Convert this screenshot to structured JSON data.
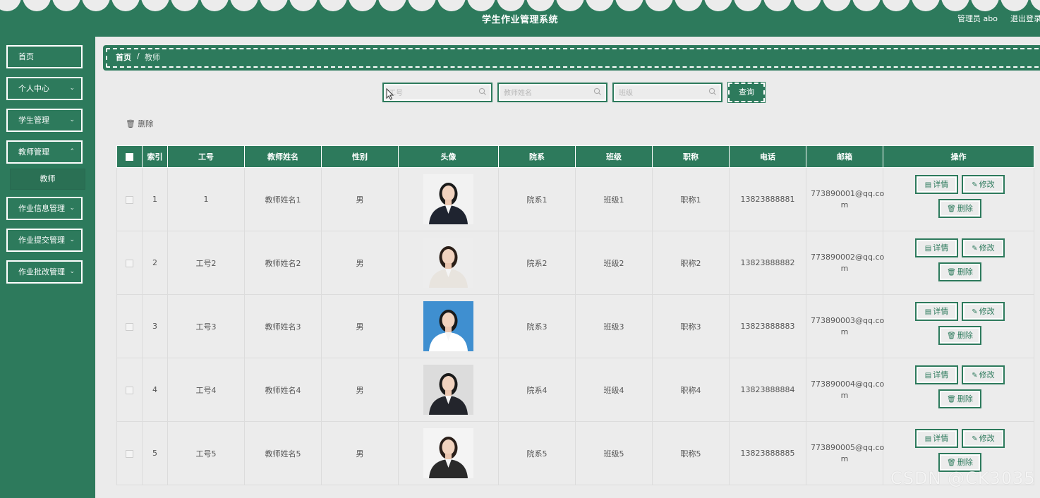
{
  "header": {
    "title": "学生作业管理系统",
    "admin_label": "管理员 abo",
    "logout_label": "退出登录"
  },
  "sidebar": {
    "items": [
      {
        "label": "首页"
      },
      {
        "label": "个人中心"
      },
      {
        "label": "学生管理"
      },
      {
        "label": "教师管理"
      },
      {
        "label": "作业信息管理"
      },
      {
        "label": "作业提交管理"
      },
      {
        "label": "作业批改管理"
      }
    ],
    "submenu_label": "教师"
  },
  "breadcrumb": {
    "home": "首页",
    "separator": "/",
    "current": "教师"
  },
  "search": {
    "job_number_placeholder": "工号",
    "teacher_name_placeholder": "教师姓名",
    "class_placeholder": "班级",
    "query_label": "查询"
  },
  "toolbar": {
    "delete_label": "删除"
  },
  "table": {
    "headers": [
      "索引",
      "工号",
      "教师姓名",
      "性别",
      "头像",
      "院系",
      "班级",
      "职称",
      "电话",
      "邮箱",
      "操作"
    ],
    "rows": [
      {
        "index": "1",
        "job_number": "1",
        "name": "教师姓名1",
        "gender": "男",
        "department": "院系1",
        "class": "班级1",
        "title": "职称1",
        "phone": "13823888881",
        "email_line1": "773890001@qq.co",
        "email_line2": "m"
      },
      {
        "index": "2",
        "job_number": "工号2",
        "name": "教师姓名2",
        "gender": "男",
        "department": "院系2",
        "class": "班级2",
        "title": "职称2",
        "phone": "13823888882",
        "email_line1": "773890002@qq.co",
        "email_line2": "m"
      },
      {
        "index": "3",
        "job_number": "工号3",
        "name": "教师姓名3",
        "gender": "男",
        "department": "院系3",
        "class": "班级3",
        "title": "职称3",
        "phone": "13823888883",
        "email_line1": "773890003@qq.co",
        "email_line2": "m"
      },
      {
        "index": "4",
        "job_number": "工号4",
        "name": "教师姓名4",
        "gender": "男",
        "department": "院系4",
        "class": "班级4",
        "title": "职称4",
        "phone": "13823888884",
        "email_line1": "773890004@qq.co",
        "email_line2": "m"
      },
      {
        "index": "5",
        "job_number": "工号5",
        "name": "教师姓名5",
        "gender": "男",
        "department": "院系5",
        "class": "班级5",
        "title": "职称5",
        "phone": "13823888885",
        "email_line1": "773890005@qq.co",
        "email_line2": "m"
      }
    ],
    "actions": {
      "detail": "详情",
      "edit": "修改",
      "delete": "删除"
    }
  },
  "watermark": "CSDN @CK3035",
  "colors": {
    "primary": "#2d7a5c",
    "background": "#ebebeb"
  }
}
